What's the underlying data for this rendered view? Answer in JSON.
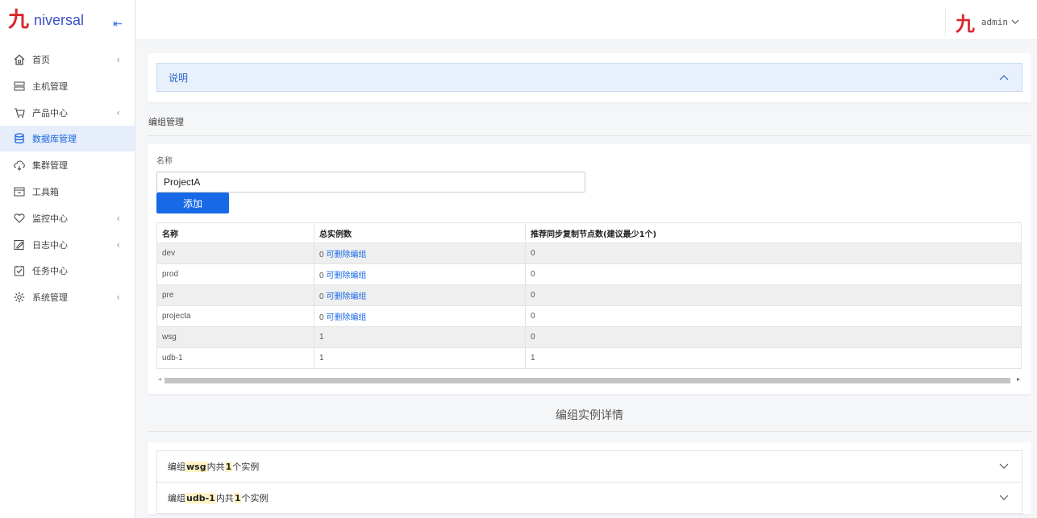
{
  "brand": {
    "logo_mark": "九",
    "logo_text": "niversal",
    "collapse_icon": "collapse-left-icon"
  },
  "user": {
    "logo_mark": "九",
    "name": "admin"
  },
  "sidebar": {
    "items": [
      {
        "label": "首页",
        "icon": "home-icon",
        "has_arrow": true
      },
      {
        "label": "主机管理",
        "icon": "server-icon",
        "has_arrow": false
      },
      {
        "label": "产品中心",
        "icon": "cart-icon",
        "has_arrow": true
      },
      {
        "label": "数据库管理",
        "icon": "database-icon",
        "has_arrow": false,
        "active": true
      },
      {
        "label": "集群管理",
        "icon": "cluster-icon",
        "has_arrow": false
      },
      {
        "label": "工具箱",
        "icon": "toolbox-icon",
        "has_arrow": false
      },
      {
        "label": "监控中心",
        "icon": "heart-icon",
        "has_arrow": true
      },
      {
        "label": "日志中心",
        "icon": "edit-log-icon",
        "has_arrow": true
      },
      {
        "label": "任务中心",
        "icon": "task-check-icon",
        "has_arrow": false
      },
      {
        "label": "系统管理",
        "icon": "gear-icon",
        "has_arrow": true
      }
    ]
  },
  "explain": {
    "label": "说明"
  },
  "group_section": {
    "title": "编组管理",
    "name_label": "名称",
    "name_value": "ProjectA",
    "add_label": "添加",
    "columns": [
      "名称",
      "总实例数",
      "推荐同步复制节点数(建议最少1个)"
    ],
    "rows": [
      {
        "name": "dev",
        "count": "0",
        "link": "可删除编组",
        "sync": "0"
      },
      {
        "name": "prod",
        "count": "0",
        "link": "可删除编组",
        "sync": "0"
      },
      {
        "name": "pre",
        "count": "0",
        "link": "可删除编组",
        "sync": "0"
      },
      {
        "name": "projecta",
        "count": "0",
        "link": "可删除编组",
        "sync": "0"
      },
      {
        "name": "wsg",
        "count": "1",
        "link": "",
        "sync": "0"
      },
      {
        "name": "udb-1",
        "count": "1",
        "link": "",
        "sync": "1"
      }
    ]
  },
  "detail_section": {
    "title": "编组实例详情",
    "rows": [
      {
        "prefix": "编组",
        "group": "wsg",
        "middle": "内共",
        "count": "1",
        "suffix": "个实例"
      },
      {
        "prefix": "编组",
        "group": "udb-1",
        "middle": "内共",
        "count": "1",
        "suffix": "个实例"
      }
    ]
  }
}
